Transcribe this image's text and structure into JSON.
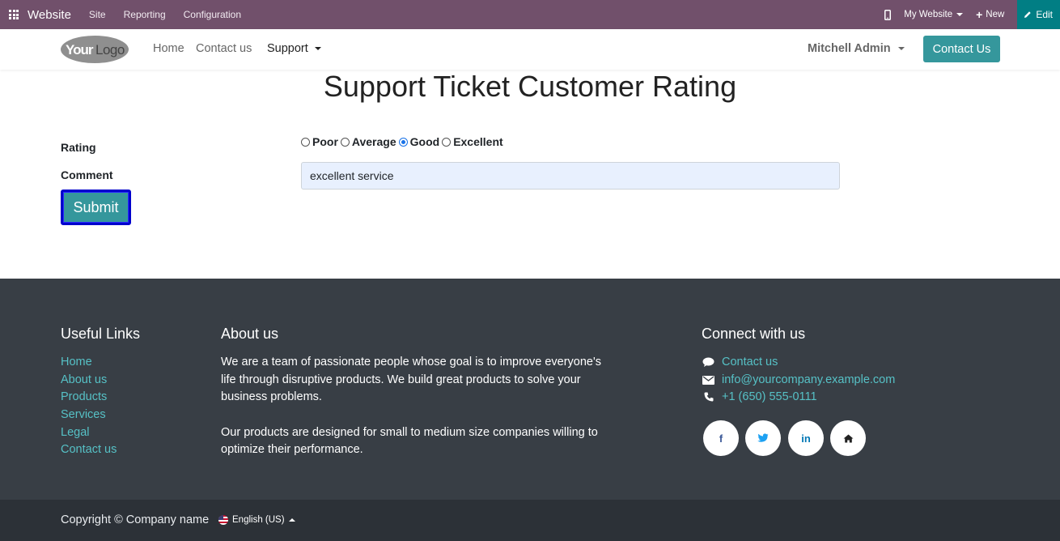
{
  "admin_bar": {
    "app_name": "Website",
    "menus": [
      "Site",
      "Reporting",
      "Configuration"
    ],
    "my_website": "My Website",
    "new_label": "New",
    "edit_label": "Edit"
  },
  "nav": {
    "logo_text": "YourLogo",
    "links": [
      "Home",
      "Contact us"
    ],
    "support": "Support",
    "user": "Mitchell Admin",
    "contact_button": "Contact Us"
  },
  "form": {
    "title": "Support Ticket Customer Rating",
    "rating_label": "Rating",
    "options": [
      "Poor",
      "Average",
      "Good",
      "Excellent"
    ],
    "selected_option": "Good",
    "comment_label": "Comment",
    "comment_value": "excellent service",
    "submit_label": "Submit"
  },
  "footer": {
    "useful_links_title": "Useful Links",
    "useful_links": [
      "Home",
      "About us",
      "Products",
      "Services",
      "Legal",
      "Contact us"
    ],
    "about_title": "About us",
    "about_p1_lines": [
      "We are a team of passionate people whose goal is to improve everyone's",
      "life through disruptive products. We build great products to solve your",
      "business problems."
    ],
    "about_p2_lines": [
      "Our products are designed for small to medium size companies willing to",
      "optimize their performance."
    ],
    "connect_title": "Connect with us",
    "contact_link": "Contact us",
    "email": "info@yourcompany.example.com",
    "phone": "+1 (650) 555-0111",
    "social": [
      "f",
      "t",
      "in",
      "home"
    ]
  },
  "bottom": {
    "copyright": "Copyright © Company name",
    "language": "English (US)"
  },
  "colors": {
    "admin_bar": "#71506b",
    "accent": "#35979c",
    "footer_bg": "#383e45",
    "link": "#56c1c6"
  }
}
